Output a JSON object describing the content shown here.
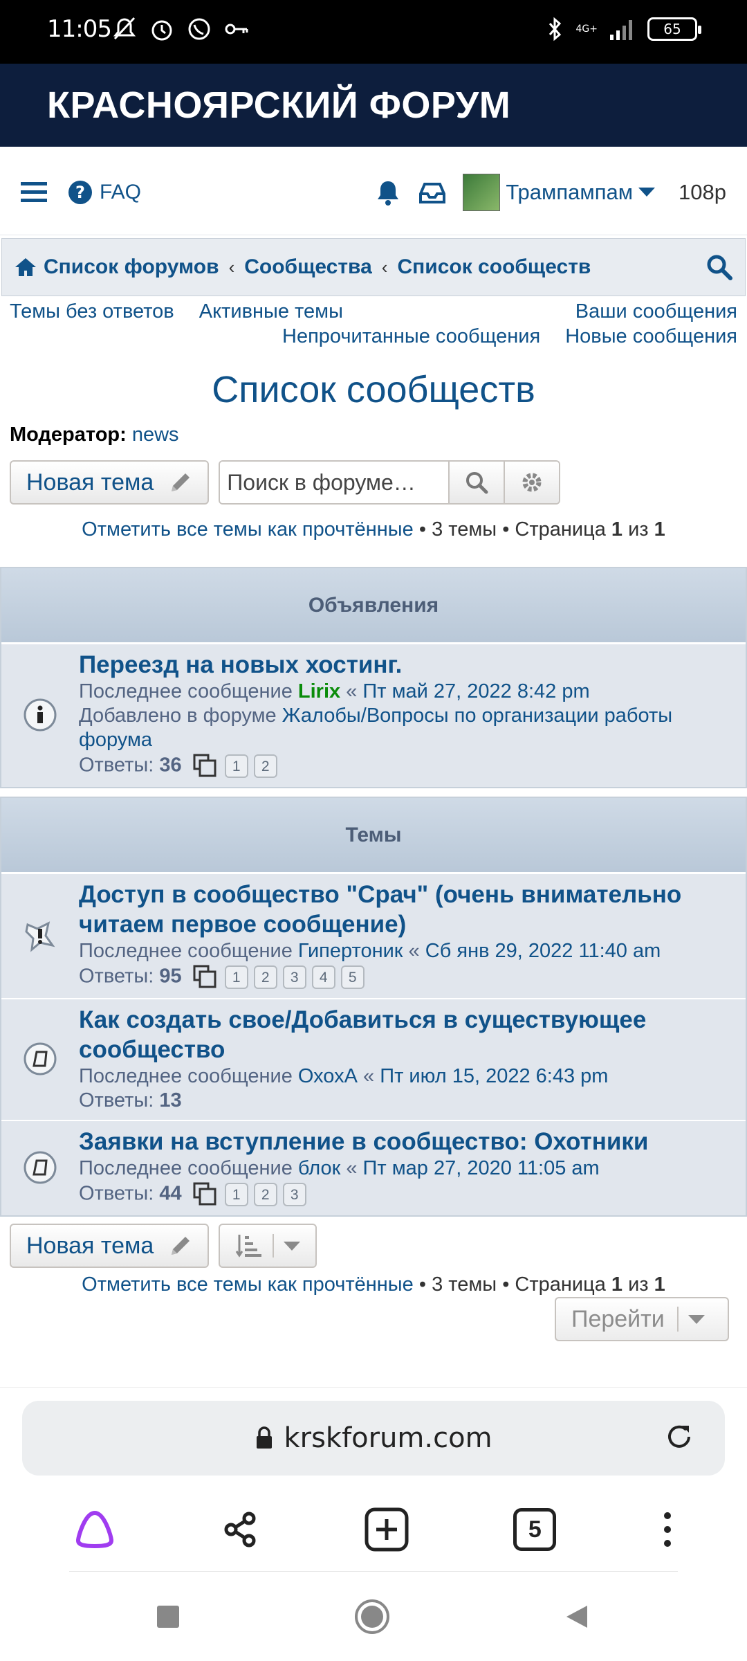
{
  "status": {
    "time": "11:05",
    "network": "4G+",
    "battery": "65"
  },
  "header": {
    "title": "КРАСНОЯРСКИЙ ФОРУМ"
  },
  "navbar": {
    "faq": "FAQ",
    "username": "Трампампам",
    "points": "108р"
  },
  "breadcrumbs": [
    "Список форумов",
    "Сообщества",
    "Список сообществ"
  ],
  "quicklinks": {
    "unanswered": "Темы без ответов",
    "active": "Активные темы",
    "your_posts": "Ваши сообщения",
    "unread": "Непрочитанные сообщения",
    "new_posts": "Новые сообщения"
  },
  "page": {
    "title": "Список сообществ",
    "moderator_label": "Модератор:",
    "moderator_name": "news"
  },
  "actions": {
    "new_topic": "Новая тема",
    "search_placeholder": "Поиск в форуме…"
  },
  "pagination": {
    "mark_read": "Отметить все темы как прочтённые",
    "topics_count": "3 темы",
    "page_label": "Страница",
    "page_current": "1",
    "of": "из",
    "page_total": "1",
    "bullet": "•"
  },
  "announcements": {
    "header": "Объявления",
    "items": [
      {
        "title": "Переезд на новых хостинг.",
        "last_label": "Последнее сообщение",
        "author": "Lirix",
        "date": "Пт май 27, 2022 8:42 pm",
        "added_label": "Добавлено в форуме",
        "forum": "Жалобы/Вопросы по организации работы форума",
        "replies_label": "Ответы:",
        "replies": "36",
        "pages": [
          "1",
          "2"
        ]
      }
    ]
  },
  "topics": {
    "header": "Темы",
    "items": [
      {
        "title": "Доступ в сообщество \"Срач\" (очень внимательно читаем первое сообщение)",
        "last_label": "Последнее сообщение",
        "author": "Гипертоник",
        "date": "Сб янв 29, 2022 11:40 am",
        "replies_label": "Ответы:",
        "replies": "95",
        "pages": [
          "1",
          "2",
          "3",
          "4",
          "5"
        ]
      },
      {
        "title": "Как создать свое/Добавиться в существующее сообщество",
        "last_label": "Последнее сообщение",
        "author": "ОхохА",
        "date": "Пт июл 15, 2022 6:43 pm",
        "replies_label": "Ответы:",
        "replies": "13",
        "pages": []
      },
      {
        "title": "Заявки на вступление в сообщество: Охотники",
        "last_label": "Последнее сообщение",
        "author": "блок",
        "date": "Пт мар 27, 2020 11:05 am",
        "replies_label": "Ответы:",
        "replies": "44",
        "pages": [
          "1",
          "2",
          "3"
        ]
      }
    ]
  },
  "jump": {
    "label": "Перейти"
  },
  "browser": {
    "url": "krskforum.com",
    "tabs_count": "5"
  },
  "colors": {
    "header_bg": "#0d1e3d",
    "link": "#105289",
    "panel": "#e1e6ed"
  }
}
